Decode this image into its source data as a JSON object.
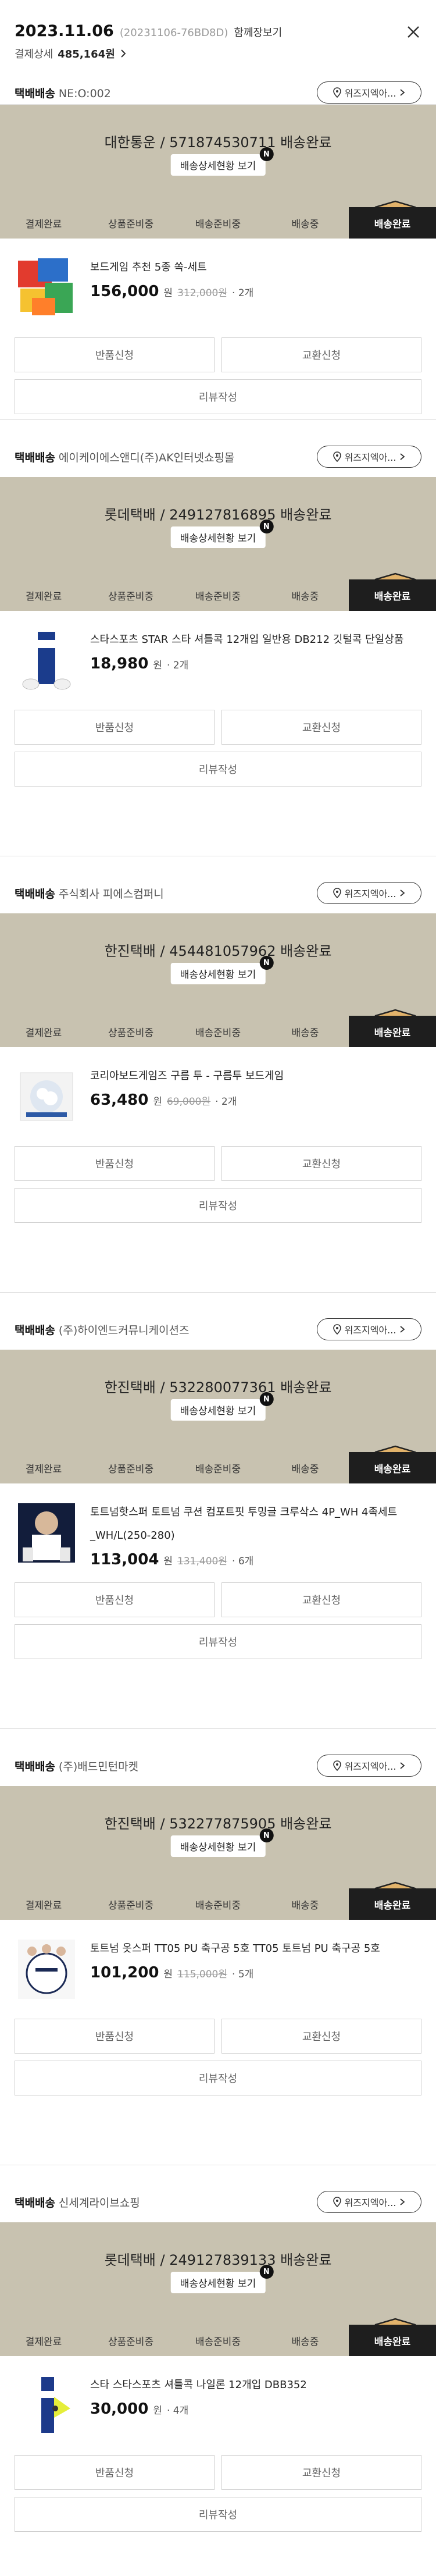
{
  "header": {
    "date": "2023.11.06",
    "order_no": "(20231106-76BD8D)",
    "merged_label": "함께장보기",
    "payment_label": "결제상세",
    "payment_amount": "485,164원"
  },
  "common": {
    "ship_type": "택배배송",
    "location_btn": "위즈지엑아...",
    "track_btn": "배송상세현황 보기",
    "new_badge": "N",
    "steps": [
      "결제완료",
      "상품준비중",
      "배송준비중",
      "배송중",
      "배송완료"
    ],
    "return_btn": "반품신청",
    "exchange_btn": "교환신청",
    "review_btn": "리뷰작성",
    "won": "원"
  },
  "shipments": [
    {
      "seller": "NE:O:002",
      "carrier_status": "대한통운 / 571874530711 배송완료",
      "product_name": "보드게임 추천 5종 쏙-세트",
      "price": "156,000",
      "original_price": "312,000원",
      "qty": "· 2개"
    },
    {
      "seller": "에이케이에스앤디(주)AK인터넷쇼핑몰",
      "carrier_status": "롯데택배 / 249127816895 배송완료",
      "product_name": "스타스포츠 STAR 스타 셔틀콕 12개입 일반용 DB212 깃털콕 단일상품",
      "price": "18,980",
      "original_price": "",
      "qty": "· 2개"
    },
    {
      "seller": "주식회사 피에스컴퍼니",
      "carrier_status": "한진택배 / 454481057962 배송완료",
      "product_name": "코리아보드게임즈 구름 투 - 구름투 보드게임",
      "price": "63,480",
      "original_price": "69,000원",
      "qty": "· 2개"
    },
    {
      "seller": "(주)하이엔드커뮤니케이션즈",
      "carrier_status": "한진택배 / 532280077361 배송완료",
      "product_name": "토트넘핫스퍼 토트넘 쿠션 컴포트핏 투밍글 크루삭스 4P_WH 4족세트_WH/L(250-280)",
      "price": "113,004",
      "original_price": "131,400원",
      "qty": "· 6개"
    },
    {
      "seller": "(주)배드민턴마켓",
      "carrier_status": "한진택배 / 532277875905 배송완료",
      "product_name": "토트넘 옷스퍼 TT05 PU 축구공 5호 TT05 토트넘 PU 축구공 5호",
      "price": "101,200",
      "original_price": "115,000원",
      "qty": "· 5개"
    },
    {
      "seller": "신세계라이브쇼핑",
      "carrier_status": "롯데택배 / 249127839133 배송완료",
      "product_name": "스타 스타스포츠 셔틀콕 나일론 12개입 DBB352",
      "price": "30,000",
      "original_price": "",
      "qty": "· 4개"
    }
  ]
}
